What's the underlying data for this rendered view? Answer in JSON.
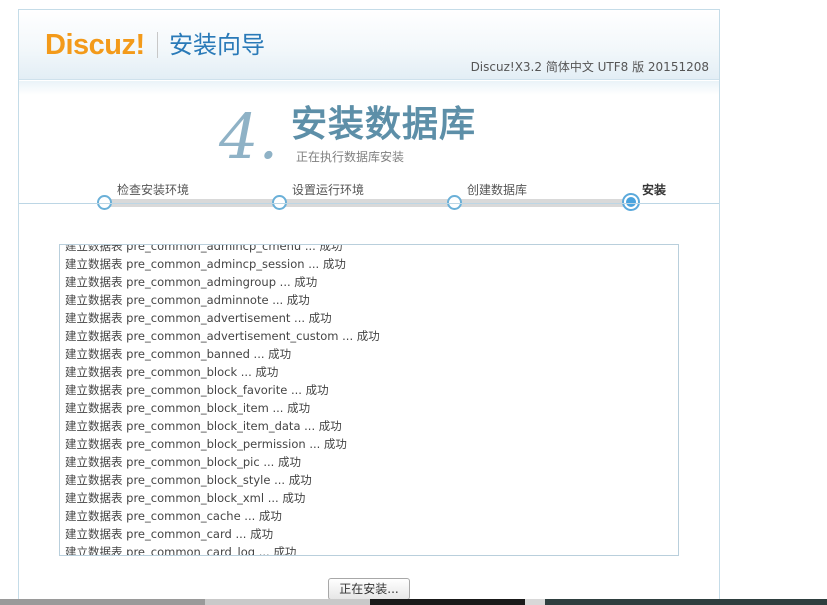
{
  "header": {
    "logo_text": "Discuz!",
    "wizard_title": "安装向导",
    "version": "Discuz!X3.2 简体中文 UTF8 版 20151208"
  },
  "step": {
    "number": "4.",
    "title": "安装数据库",
    "subtitle": "正在执行数据库安装"
  },
  "steps": [
    {
      "label": "检查安装环境",
      "active": false
    },
    {
      "label": "设置运行环境",
      "active": false
    },
    {
      "label": "创建数据库",
      "active": false
    },
    {
      "label": "安装",
      "active": true
    }
  ],
  "log": {
    "partial_top": "建立数据表 pre_common_admincp_cmenu ... 成功",
    "lines": [
      "建立数据表 pre_common_admincp_session ... 成功",
      "建立数据表 pre_common_admingroup ... 成功",
      "建立数据表 pre_common_adminnote ... 成功",
      "建立数据表 pre_common_advertisement ... 成功",
      "建立数据表 pre_common_advertisement_custom ... 成功",
      "建立数据表 pre_common_banned ... 成功",
      "建立数据表 pre_common_block ... 成功",
      "建立数据表 pre_common_block_favorite ... 成功",
      "建立数据表 pre_common_block_item ... 成功",
      "建立数据表 pre_common_block_item_data ... 成功",
      "建立数据表 pre_common_block_permission ... 成功",
      "建立数据表 pre_common_block_pic ... 成功",
      "建立数据表 pre_common_block_style ... 成功",
      "建立数据表 pre_common_block_xml ... 成功",
      "建立数据表 pre_common_cache ... 成功",
      "建立数据表 pre_common_card ... 成功",
      "建立数据表 pre_common_card_log ... 成功"
    ]
  },
  "button": {
    "label": "正在安装..."
  }
}
